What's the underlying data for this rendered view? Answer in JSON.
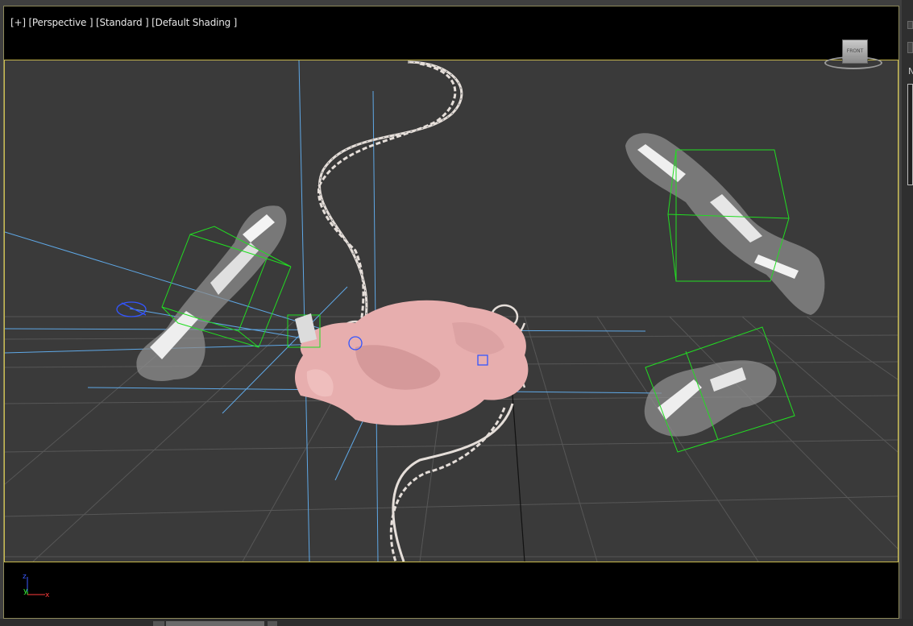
{
  "viewport": {
    "label_plus": "[+]",
    "label_view": "[Perspective ]",
    "label_mode": "[Standard ]",
    "label_shading": "[Default Shading ]",
    "viewcube_face": "FRONT",
    "axis": {
      "z": "z",
      "y": "y",
      "x": "x"
    }
  },
  "colors": {
    "viewport_bg": "#3a3a3a",
    "safe_frame": "#c8b94c",
    "grid": "#5a5a5a",
    "selection_box": "#22dd22",
    "light_lines": "#5fa8e6",
    "blob": "#e7aeae",
    "dna": "#e5ded9",
    "smoke": "#b4b4b4"
  },
  "right_panel": {
    "label": "N"
  }
}
